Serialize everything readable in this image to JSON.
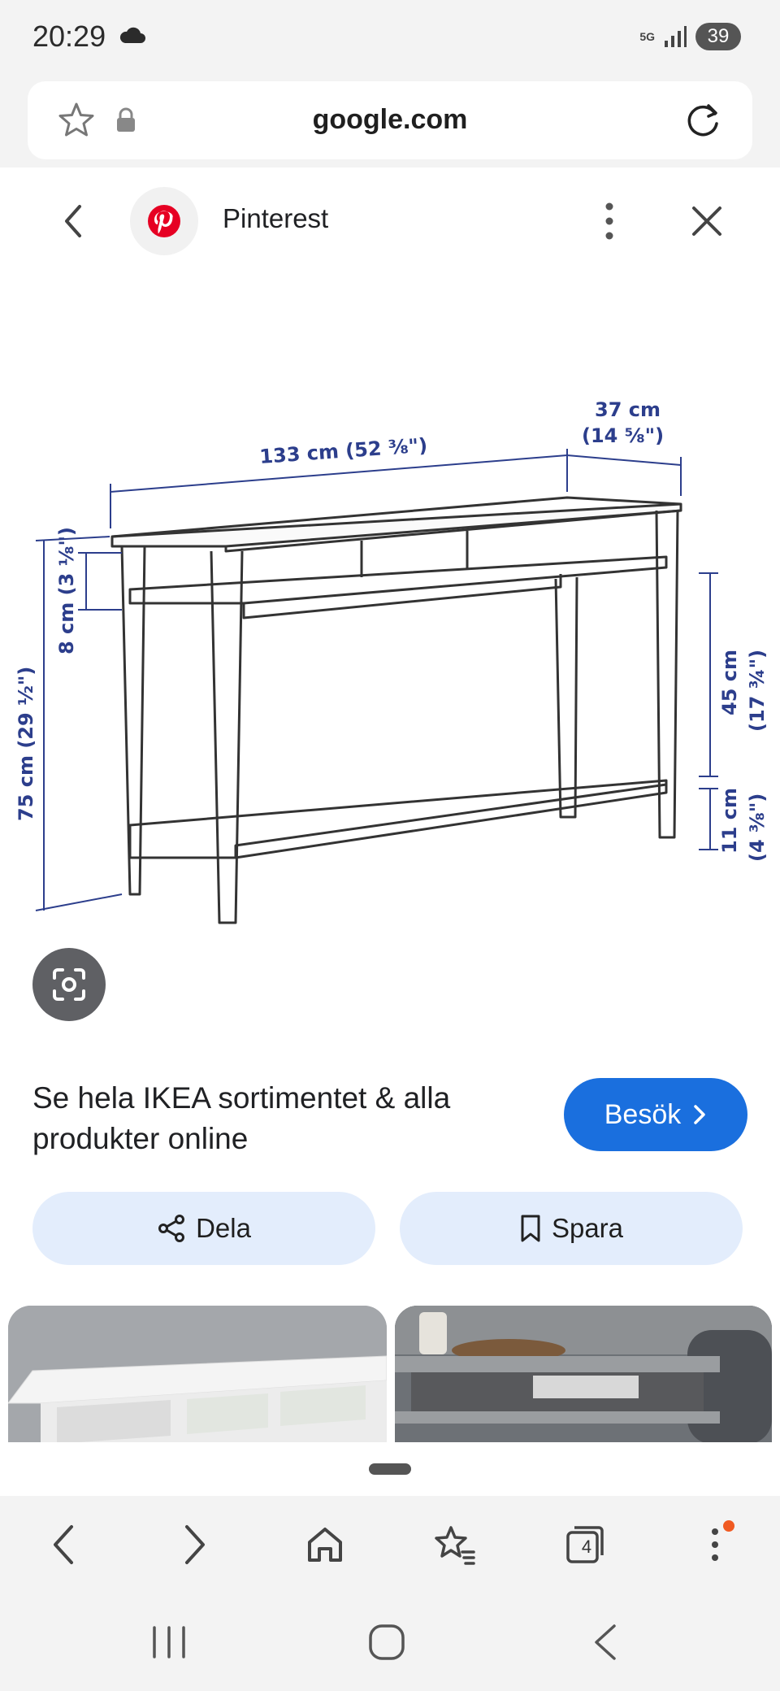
{
  "status_bar": {
    "time": "20:29",
    "network": "5G",
    "battery": "39"
  },
  "url_bar": {
    "domain": "google.com"
  },
  "source": {
    "name": "Pinterest"
  },
  "product_image": {
    "dim_width": "133 cm (52 ⅜\")",
    "dim_depth_cm": "37 cm",
    "dim_depth_in": "(14 ⅝\")",
    "dim_drawer": "8 cm (3 ⅛\")",
    "dim_height": "75 cm (29 ½\")",
    "dim_shelf_gap_cm": "45 cm",
    "dim_shelf_gap_in": "(17 ¾\")",
    "dim_shelf_floor_cm": "11 cm",
    "dim_shelf_floor_in": "(4 ⅜\")"
  },
  "result": {
    "title": "Se hela IKEA sortimentet & alla produkter online",
    "visit_label": "Besök"
  },
  "actions": {
    "share_label": "Dela",
    "save_label": "Spara"
  },
  "nav": {
    "tab_count": "4"
  },
  "colors": {
    "accent": "#1a6fde",
    "pill_bg": "#e3edfc",
    "pinterest": "#e60023",
    "notification": "#f05a22"
  }
}
